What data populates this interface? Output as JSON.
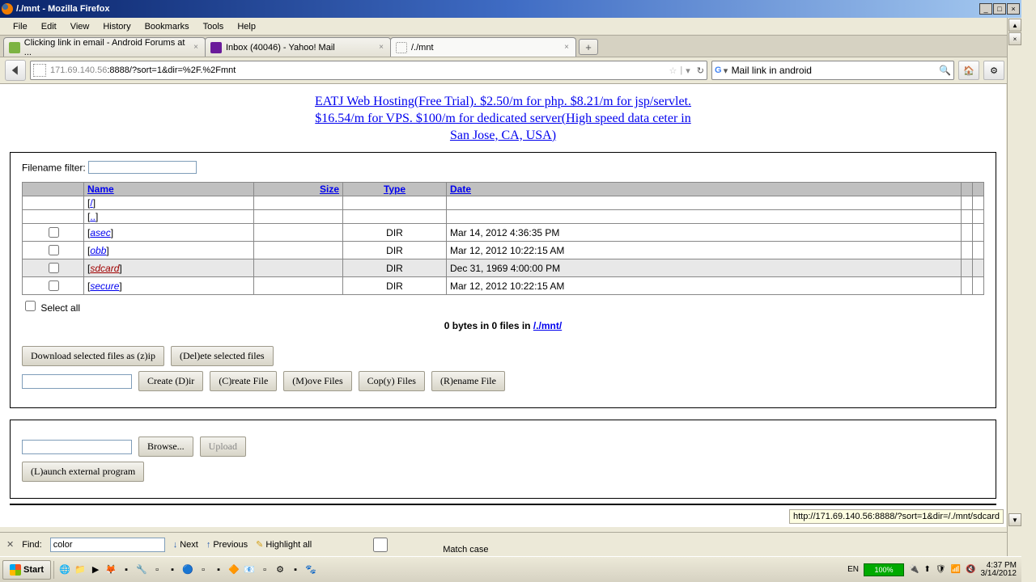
{
  "window": {
    "title": "/./mnt - Mozilla Firefox"
  },
  "menu": [
    "File",
    "Edit",
    "View",
    "History",
    "Bookmarks",
    "Tools",
    "Help"
  ],
  "tabs": [
    {
      "label": "Clicking link in email - Android Forums at ...",
      "iconColor": "#7cb342",
      "active": false
    },
    {
      "label": "Inbox (40046) - Yahoo! Mail",
      "iconColor": "#6a1b9a",
      "active": false
    },
    {
      "label": "/./mnt",
      "iconColor": "#ffffff",
      "active": true
    }
  ],
  "url": {
    "host": "171.69.140.56",
    "port": ":8888/?sort=1&dir=%2F.%2Fmnt"
  },
  "search": {
    "value": "Mail link in android"
  },
  "ad": {
    "l1": "EATJ Web Hosting(Free Trial). $2.50/m for php. $8.21/m for jsp/servlet.",
    "l2": "$16.54/m for VPS. $100/m for dedicated server(High speed data ceter in",
    "l3": "San Jose, CA, USA)"
  },
  "filterLabel": "Filename filter:",
  "columns": {
    "name": "Name",
    "size": "Size",
    "type": "Type",
    "date": "Date"
  },
  "rows": [
    {
      "name": "/",
      "brackets": true,
      "italic": false,
      "type": "",
      "date": "",
      "chk": false,
      "visited": false
    },
    {
      "name": "..",
      "brackets": true,
      "italic": false,
      "type": "",
      "date": "",
      "chk": false,
      "visited": false
    },
    {
      "name": "asec",
      "brackets": true,
      "italic": true,
      "type": "DIR",
      "date": "Mar 14, 2012 4:36:35 PM",
      "chk": true,
      "visited": false
    },
    {
      "name": "obb",
      "brackets": true,
      "italic": true,
      "type": "DIR",
      "date": "Mar 12, 2012 10:22:15 AM",
      "chk": true,
      "visited": false
    },
    {
      "name": "sdcard",
      "brackets": true,
      "italic": true,
      "type": "DIR",
      "date": "Dec 31, 1969 4:00:00 PM",
      "chk": true,
      "visited": true,
      "hover": true
    },
    {
      "name": "secure",
      "brackets": true,
      "italic": true,
      "type": "DIR",
      "date": "Mar 12, 2012 10:22:15 AM",
      "chk": true,
      "visited": false
    }
  ],
  "selectAll": "Select all",
  "summary": {
    "prefix": "0 bytes in 0 files in ",
    "path": "/./mnt/"
  },
  "buttons": {
    "downloadZip": "Download selected files as (z)ip",
    "delete": "(Del)ete selected files",
    "createDir": "Create (D)ir",
    "createFile": "(C)reate File",
    "move": "(M)ove Files",
    "copy": "Cop(y) Files",
    "rename": "(R)ename File",
    "browse": "Browse...",
    "upload": "Upload",
    "launch": "(L)aunch external program"
  },
  "statusLink": "http://171.69.140.56:8888/?sort=1&dir=/./mnt/sdcard",
  "findbar": {
    "label": "Find:",
    "value": "color",
    "next": "Next",
    "prev": "Previous",
    "highlight": "Highlight all",
    "matchcase": "Match case"
  },
  "taskbar": {
    "start": "Start",
    "lang": "EN",
    "battery": "100%",
    "time": "4:37 PM",
    "date": "3/14/2012"
  }
}
